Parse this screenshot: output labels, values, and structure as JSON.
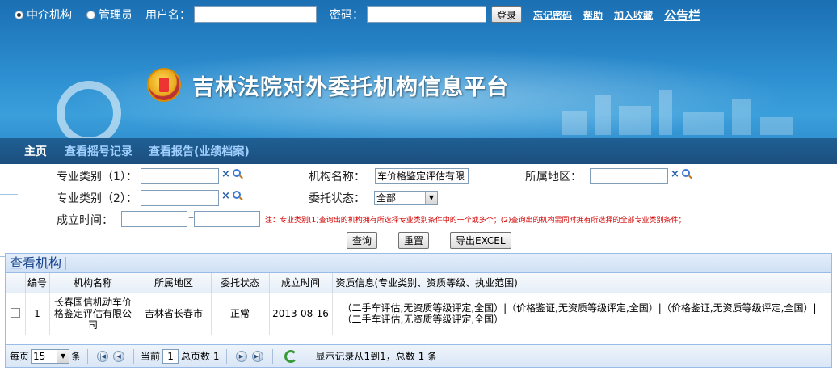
{
  "topbar": {
    "radio_agency": "中介机构",
    "radio_admin": "管理员",
    "username_label": "用户名：",
    "password_label": "密码：",
    "login_button": "登录",
    "forgot_password": "忘记密码",
    "help": "帮助",
    "add_favorite": "加入收藏",
    "bulletin": "公告栏"
  },
  "site_title": "吉林法院对外委托机构信息平台",
  "nav": {
    "home": "主页",
    "lottery_records": "查看摇号记录",
    "reports": "查看报告(业绩档案)"
  },
  "form": {
    "category1_label": "专业类别（1）：",
    "category2_label": "专业类别（2）：",
    "established_label": "成立时间：",
    "org_name_label": "机构名称：",
    "org_name_value": "车价格鉴定评估有限",
    "status_label": "委托状态：",
    "status_value": "全部",
    "region_label": "所属地区：",
    "date_separator": "–",
    "clear_symbol": "×",
    "note": "注：专业类别(1)查询出的机构拥有所选择专业类别条件中的一个或多个；(2)查询出的机构需同时拥有所选择的全部专业类别条件；",
    "search_button": "查询",
    "reset_button": "重置",
    "export_button": "导出EXCEL"
  },
  "grid": {
    "title": "查看机构",
    "headers": [
      "",
      "编号",
      "机构名称",
      "所属地区",
      "委托状态",
      "成立时间",
      "资质信息(专业类别、资质等级、执业范围)"
    ],
    "rows": [
      {
        "no": "1",
        "name": "长春国信机动车价格鉴定评估有限公司",
        "region": "吉林省长春市",
        "status": "正常",
        "date": "2013-08-16",
        "qualification": "（二手车评估,无资质等级评定,全国）|（价格鉴证,无资质等级评定,全国）|（价格鉴证,无资质等级评定,全国）|（二手车评估,无资质等级评定,全国）"
      }
    ],
    "pager": {
      "per_page_label": "每页",
      "per_page_value": "15",
      "items_unit": "条",
      "current_label": "当前",
      "current_page": "1",
      "total_pages_text": "总页数 1",
      "summary": "显示记录从1到1，总数 1 条"
    }
  },
  "colors": {
    "banner_blue": "#2c8ed0",
    "nav_bg": "#1c4f7f",
    "note_red": "#d40000",
    "grid_border": "#99bbe8"
  }
}
